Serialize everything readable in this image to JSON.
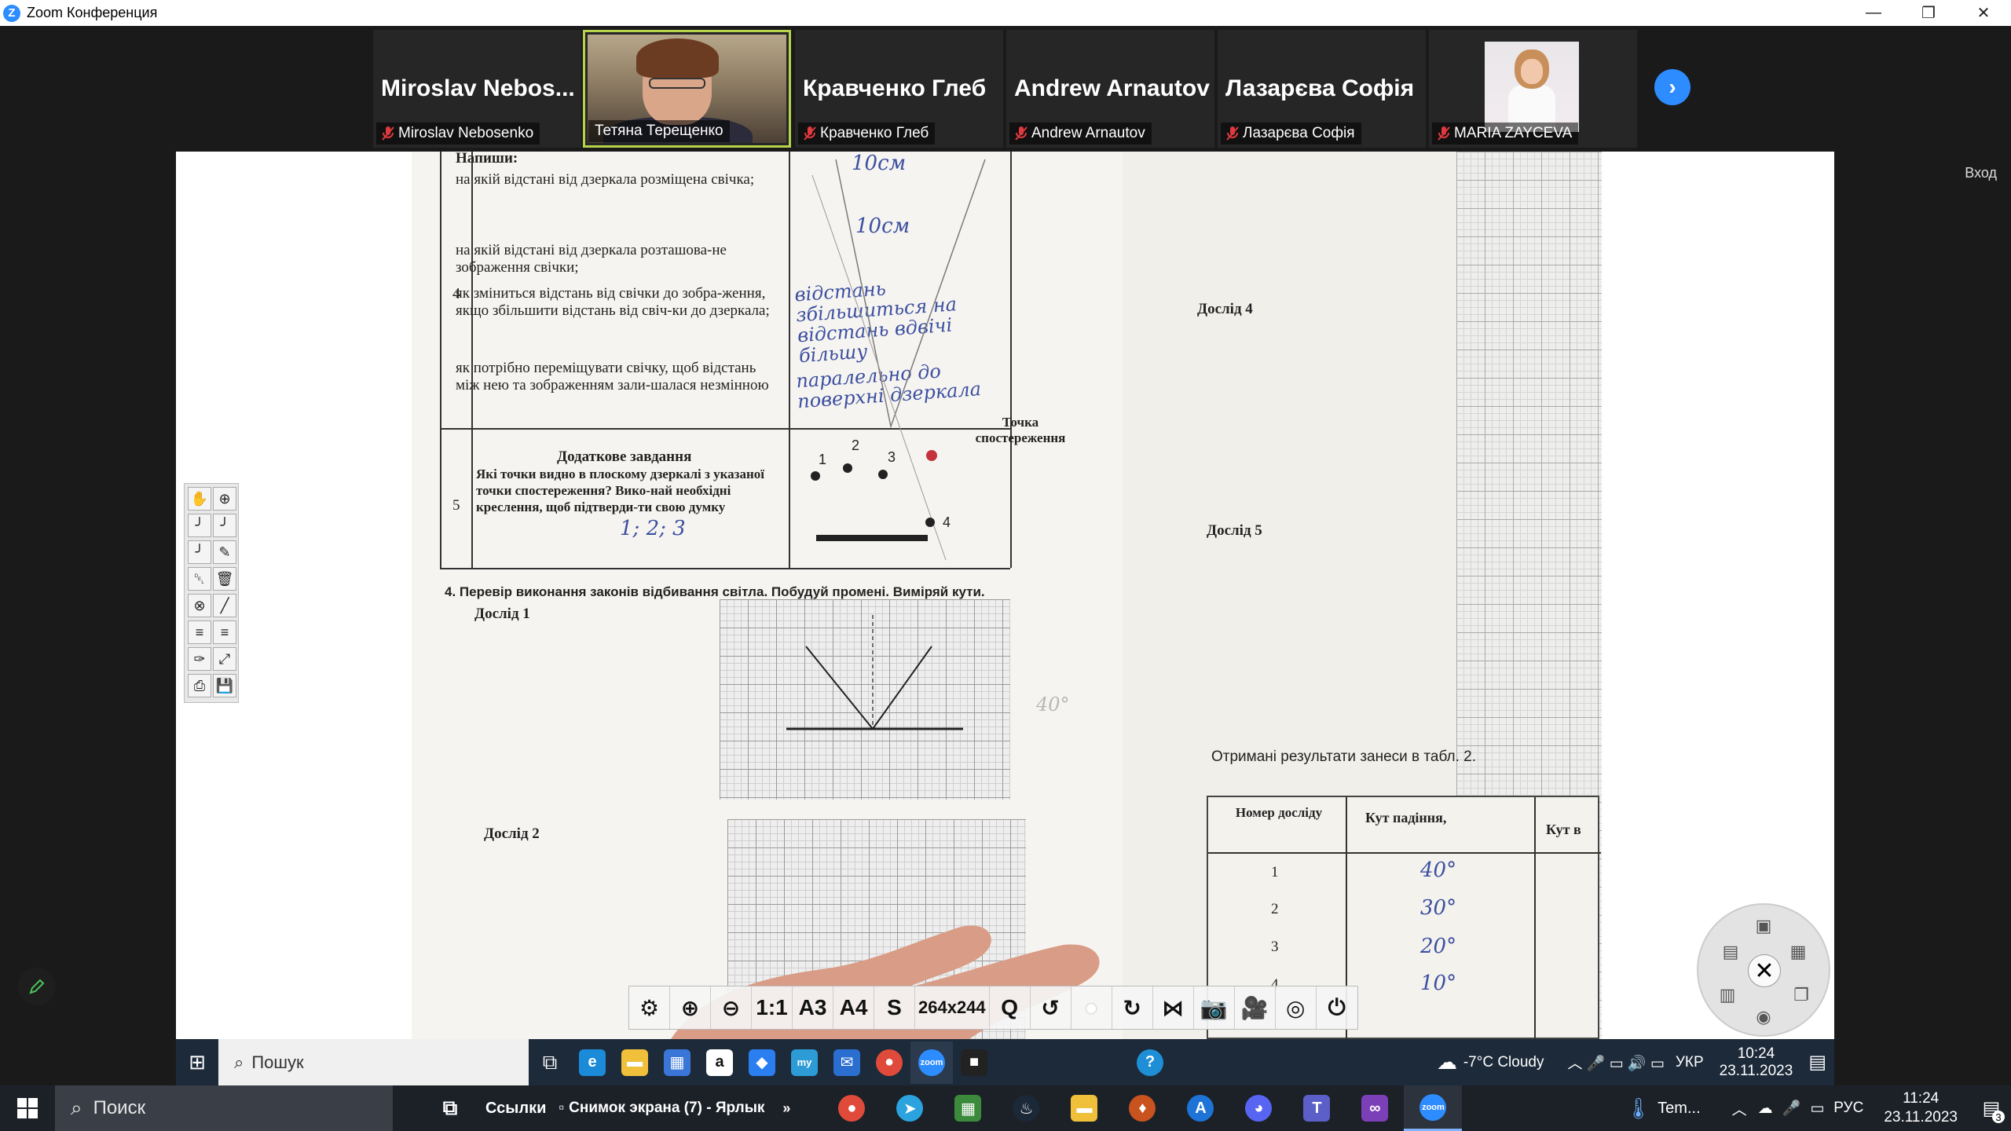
{
  "window": {
    "title": "Zoom Конференция",
    "controls": {
      "minimize": "—",
      "maximize": "❐",
      "close": "✕"
    }
  },
  "participants": [
    {
      "display_name": "Miroslav  Nebos...",
      "label": "Miroslav Nebosenko",
      "muted": true,
      "video": false
    },
    {
      "display_name": "",
      "label": "Тетяна Терещенко",
      "muted": false,
      "video": true,
      "active_speaker": true
    },
    {
      "display_name": "Кравченко Глеб",
      "label": "Кравченко Глеб",
      "muted": true,
      "video": false
    },
    {
      "display_name": "Andrew Arnautov",
      "label": "Andrew Arnautov",
      "muted": true,
      "video": false
    },
    {
      "display_name": "Лазарєва Софія",
      "label": "Лазарєва Софія",
      "muted": true,
      "video": false
    },
    {
      "display_name": "",
      "label": "MARIA ZAYCEVA",
      "muted": true,
      "video": true
    }
  ],
  "strip": {
    "next_icon": "chevron-right-icon"
  },
  "vhod_label": "Вход",
  "document": {
    "row4": {
      "heading": "Напиши:",
      "number": "4",
      "q1": "на якій відстані від дзеркала розміщена свічка;",
      "q2": "на якій відстані від дзеркала розташова-не зображення свічки;",
      "q3": "як зміниться відстань від свічки до зобра-ження, якщо збільшити відстань від свіч-ки до дзеркала;",
      "q4": "як потрібно переміщувати свічку, щоб відстань між нею та зображенням зали-шалася незмінною",
      "a1": "10см",
      "a2": "10см",
      "a3": "відстань збільшиться на відстань вдвічі більшу",
      "a4": "паралельно до поверхні дзеркала"
    },
    "row5": {
      "number": "5",
      "title": "Додаткове завдання",
      "text": "Які точки видно в плоскому дзеркалі з указаної точки спостереження? Вико-най необхідні креслення, щоб підтверди-ти свою думку",
      "answer": "1; 2; 3",
      "point_label": "Точка спостереження",
      "points": [
        "1",
        "2",
        "3",
        "4"
      ]
    },
    "task4": "4.  Перевір виконання законів відбивання світла. Побудуй промені. Виміряй кути.",
    "dosl1": "Дослід 1",
    "dosl2": "Дослід 2",
    "dosl4": "Дослід 4",
    "dosl5": "Дослід 5",
    "angle_note": "40°",
    "results_note": "Отримані результати занеси в табл. 2.",
    "table": {
      "col1": "Номер досліду",
      "col2": "Кут падіння,",
      "col3": "Кут в",
      "rows": [
        {
          "n": "1",
          "v": "40°"
        },
        {
          "n": "2",
          "v": "30°"
        },
        {
          "n": "3",
          "v": "20°"
        },
        {
          "n": "4",
          "v": "10°"
        }
      ]
    }
  },
  "camtools": [
    "⚙",
    "⊕",
    "⊖",
    "1:1",
    "A3",
    "A4",
    "S",
    "264x244",
    "Q",
    "↺",
    "●",
    "↻",
    "⋈",
    "📷",
    "🎥",
    "◎",
    "⏻"
  ],
  "inner_taskbar": {
    "search": "Пошук",
    "weather": "-7°C  Cloudy",
    "lang": "УКР",
    "time": "10:24",
    "date": "23.11.2023"
  },
  "taskbar": {
    "search": "Поиск",
    "links": "Ссылки",
    "shortcut": "Снимок экрана (7) - Ярлык",
    "temp_app": "Tem...",
    "lang": "РУС",
    "time": "11:24",
    "date": "23.11.2023",
    "notifications": "3"
  },
  "colors": {
    "zoom_blue": "#2d8cff",
    "active_border": "#b6d34a",
    "mute_red": "#e0393e",
    "ink_blue": "#3b4fa0"
  }
}
